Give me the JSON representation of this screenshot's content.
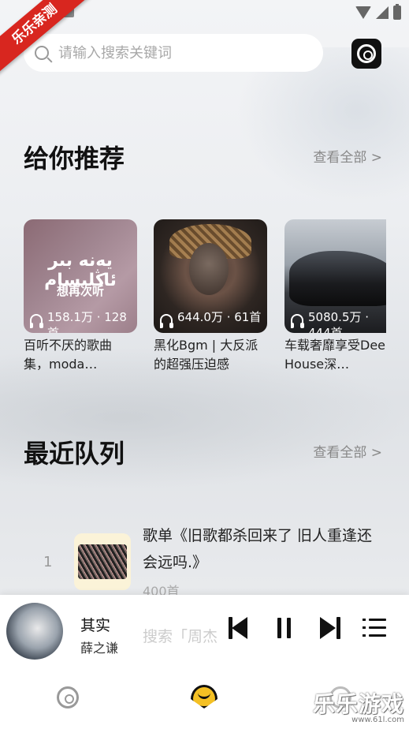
{
  "ribbon": {
    "label": "乐乐亲测"
  },
  "search": {
    "placeholder": "请输入搜索关键词"
  },
  "recommend": {
    "title": "给你推荐",
    "see_all": "查看全部 >",
    "cards": [
      {
        "cover_text": "يەنە بىر ئاڭلىسام",
        "cover_subtext": "想再次听",
        "stats": "158.1万 · 128首",
        "title": "百听不厌的歌曲集，moda…"
      },
      {
        "stats": "644.0万 · 61首",
        "title": "黑化Bgm | 大反派的超强压迫感"
      },
      {
        "stats": "5080.5万 · 444首",
        "title": "车载奢靡享受Deep House深…"
      }
    ]
  },
  "queue": {
    "title": "最近队列",
    "see_all": "查看全部 >",
    "items": [
      {
        "index": "1",
        "title": "歌单《旧歌都杀回来了 旧人重逢还会远吗.》",
        "count": "400首"
      }
    ],
    "partial_next": "搜索「周杰"
  },
  "player": {
    "song": "其实",
    "artist": "薛之谦"
  },
  "watermark": {
    "main": "乐乐游戏",
    "url": "www.61l.com"
  },
  "icons": [
    "search-icon",
    "settings-icon",
    "headphone-icon",
    "prev-icon",
    "pause-icon",
    "next-icon",
    "playlist-icon",
    "disc-icon",
    "heart-icon",
    "user-icon"
  ],
  "colors": {
    "ribbon": "#d8261f",
    "accent_heart": "#f4c024",
    "text_primary": "#111111",
    "text_secondary": "#888888"
  }
}
